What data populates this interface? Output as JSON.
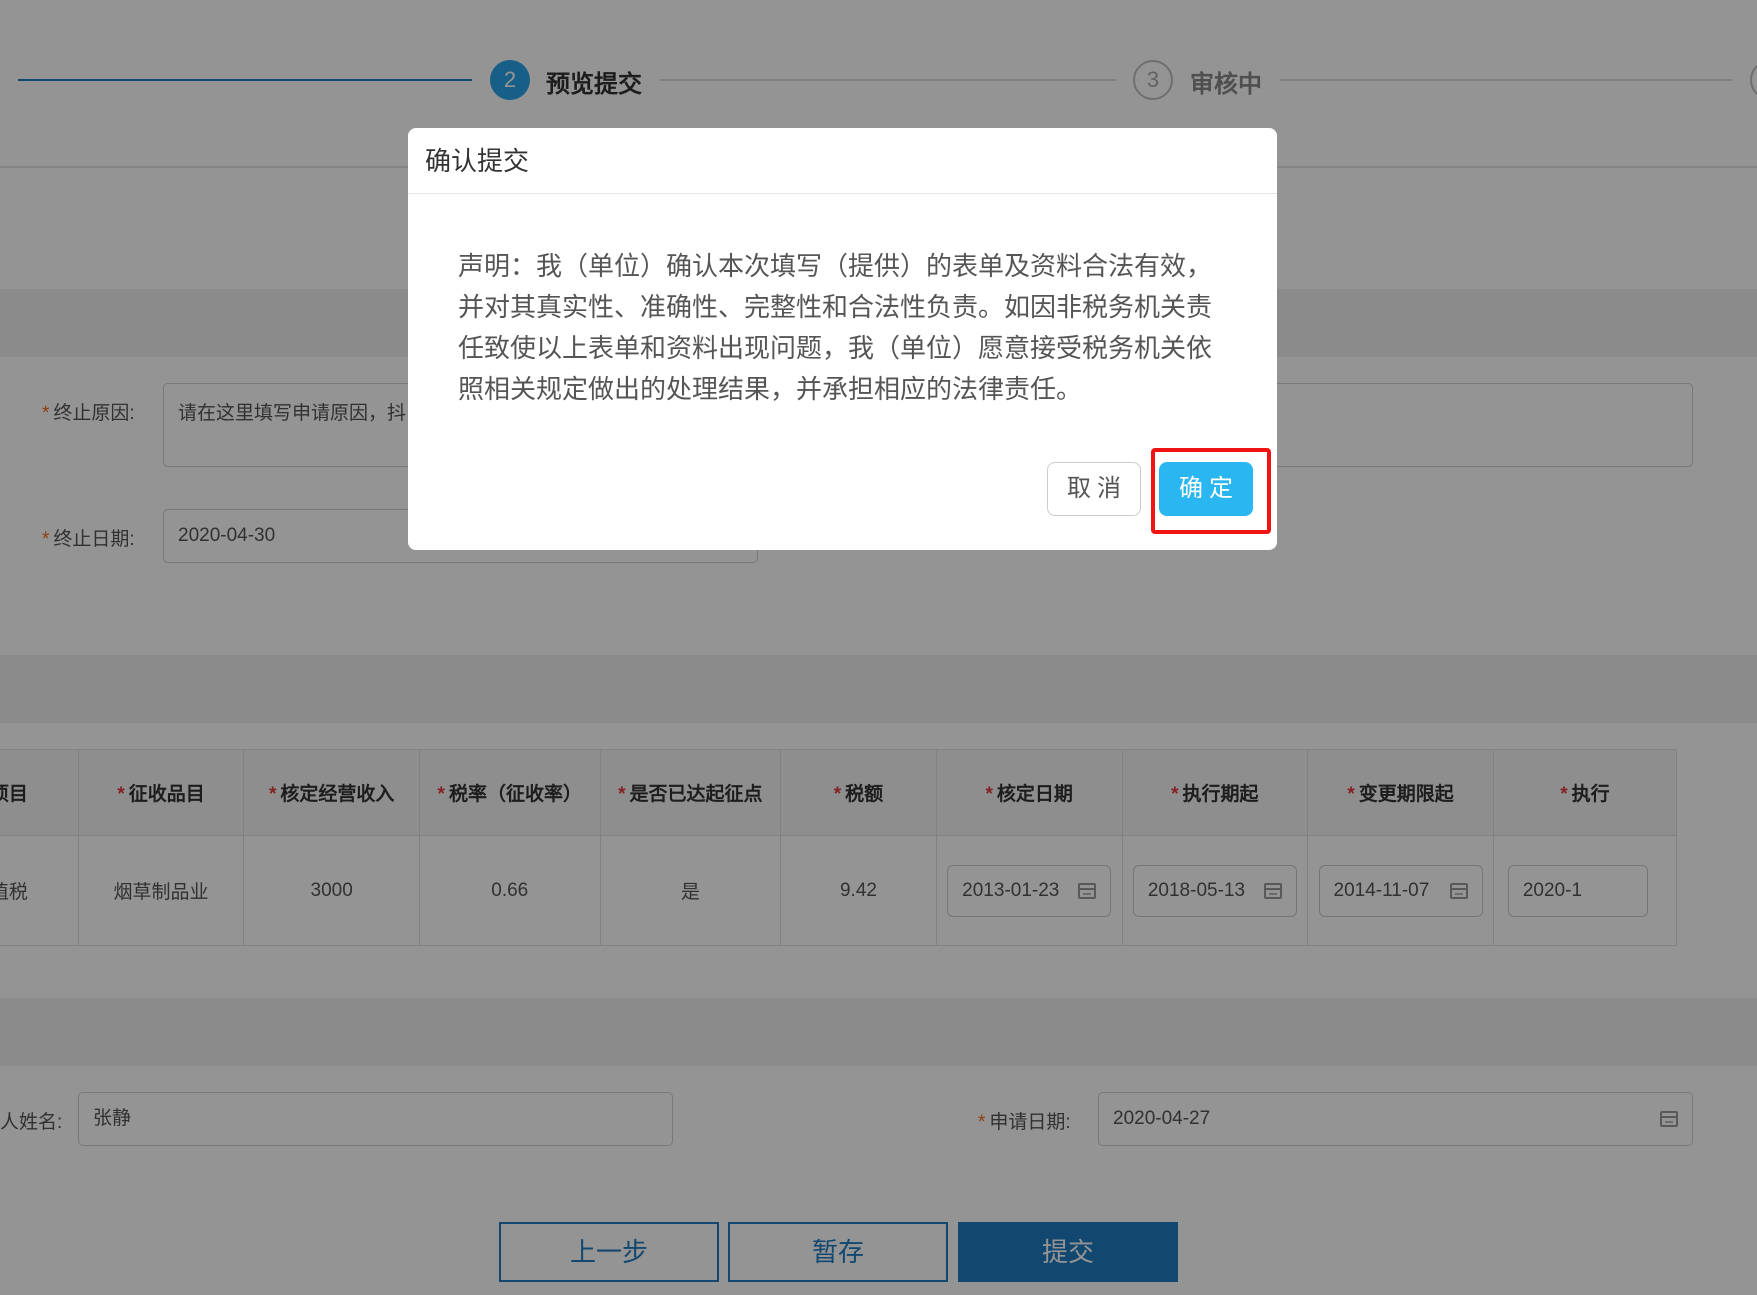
{
  "steps": [
    {
      "number": "2",
      "label": "预览提交",
      "state": "active"
    },
    {
      "number": "3",
      "label": "审核中",
      "state": "pending"
    }
  ],
  "form": {
    "reason_label": "终止原因:",
    "reason_placeholder": "请在这里填写申请原因，",
    "reason_placeholder_cont": "抖",
    "end_date_label": "终止日期:",
    "end_date_value": "2020-04-30",
    "applicant_label": "人姓名:",
    "applicant_value": "张静",
    "apply_date_label": "申请日期:",
    "apply_date_value": "2020-04-27"
  },
  "table": {
    "headers": [
      "收项目",
      "征收品目",
      "核定经营收入",
      "税率（征收率）",
      "是否已达起征点",
      "税额",
      "核定日期",
      "执行期起",
      "变更期限起",
      "执行"
    ],
    "row": {
      "item": "增值税",
      "category": "烟草制品业",
      "income": "3000",
      "rate": "0.66",
      "reached": "是",
      "tax": "9.42",
      "approved_date": "2013-01-23",
      "exec_start": "2018-05-13",
      "change_start": "2014-11-07",
      "exec_partial": "2020-1"
    }
  },
  "buttons": {
    "prev": "上一步",
    "save": "暂存",
    "submit": "提交"
  },
  "modal": {
    "title": "确认提交",
    "body": "声明：我（单位）确认本次填写（提供）的表单及资料合法有效，并对其真实性、准确性、完整性和合法性负责。如因非税务机关责任致使以上表单和资料出现问题，我（单位）愿意接受税务机关依照相关规定做出的处理结果，并承担相应的法律责任。",
    "cancel": "取消",
    "ok": "确定"
  },
  "colors": {
    "primary": "#1f7dc1",
    "confirm": "#2ab6f0",
    "required": "#f26b1d",
    "highlight": "#f01414"
  }
}
